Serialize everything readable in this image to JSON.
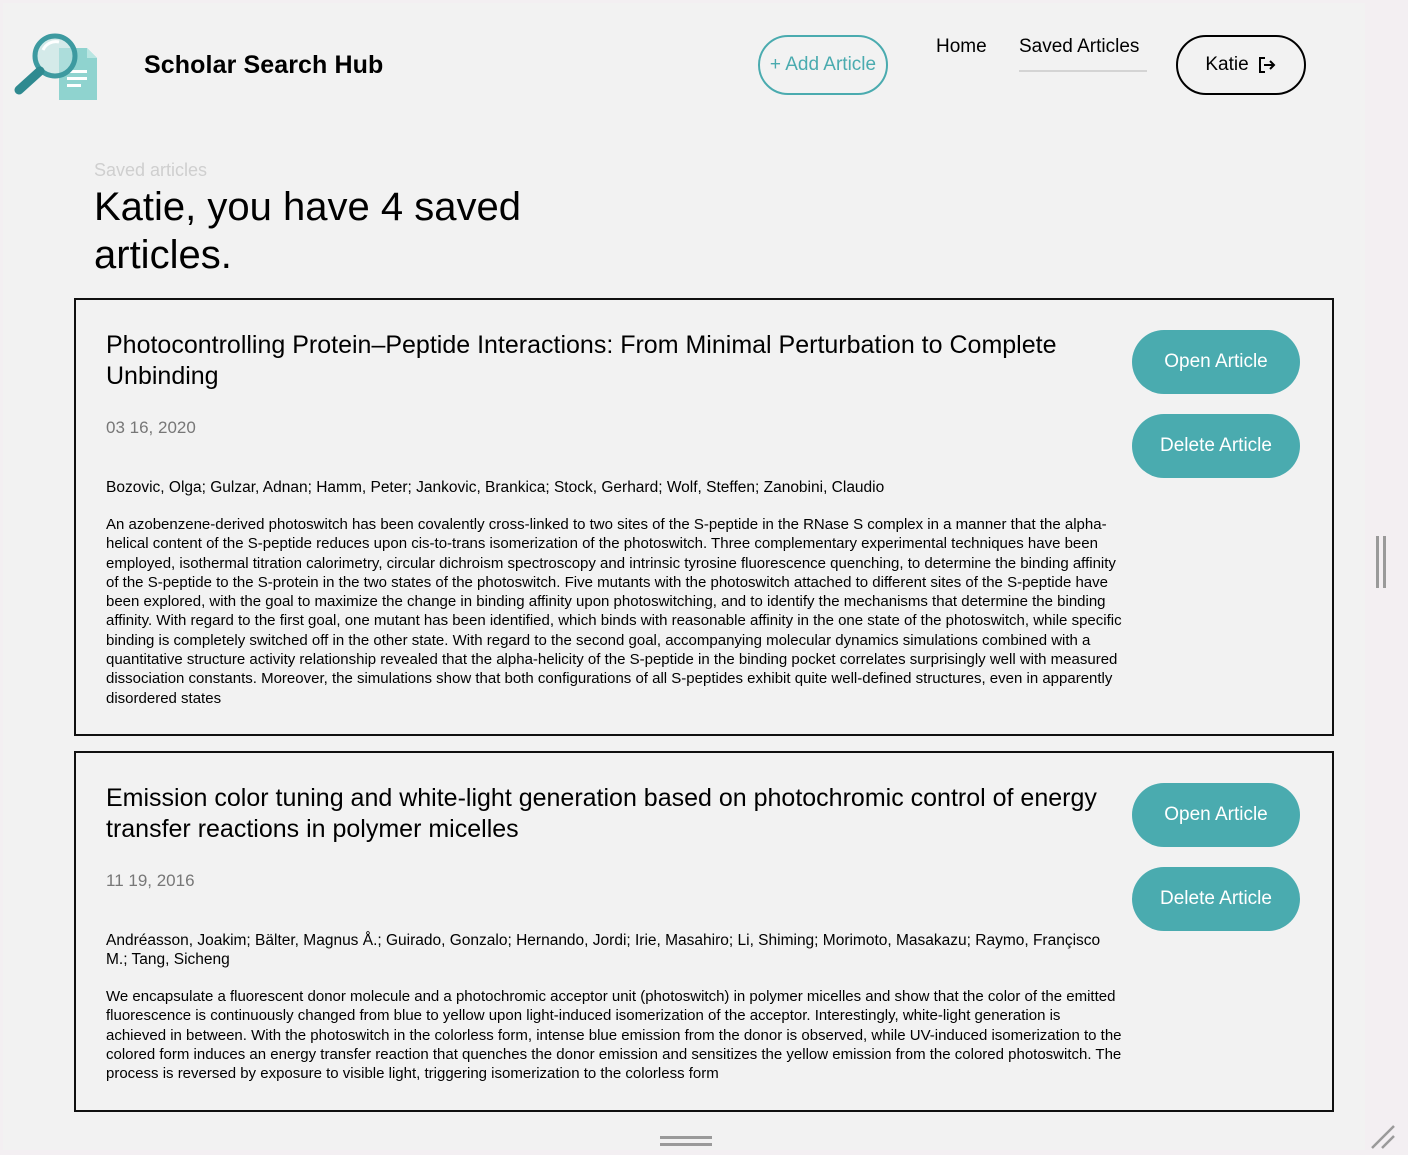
{
  "header": {
    "brand": "Scholar Search Hub",
    "add_label": "+ Add Article",
    "nav": {
      "home": "Home",
      "saved": "Saved Articles"
    },
    "user_name": "Katie"
  },
  "page": {
    "eyebrow": "Saved articles",
    "title": "Katie, you have 4 saved articles."
  },
  "articles": [
    {
      "title": "Photocontrolling Protein–Peptide Interactions: From Minimal Perturbation to Complete Unbinding",
      "date": "03 16, 2020",
      "authors": "Bozovic, Olga; Gulzar, Adnan; Hamm, Peter; Jankovic, Brankica; Stock, Gerhard; Wolf, Steffen; Zanobini, Claudio",
      "abstract": "An azobenzene-derived photoswitch has been covalently cross-linked to two sites of the S-peptide in the RNase S complex in a manner that the alpha-helical content of the S-peptide reduces upon cis-to-trans isomerization of the photoswitch. Three complementary experimental techniques have been employed, isothermal titration calorimetry, circular dichroism spectroscopy and intrinsic tyrosine fluorescence quenching, to determine the binding affinity of the S-peptide to the S-protein in the two states of the photoswitch. Five mutants with the photoswitch attached to different sites of the S-peptide have been explored, with the goal to maximize the change in binding affinity upon photoswitching, and to identify the mechanisms that determine the binding affinity. With regard to the first goal, one mutant has been identified, which binds with reasonable affinity in the one state of the photoswitch, while specific binding is completely switched off in the other state. With regard to the second goal, accompanying molecular dynamics simulations combined with a quantitative structure activity relationship revealed that the alpha-helicity of the S-peptide in the binding pocket correlates surprisingly well with measured dissociation constants. Moreover, the simulations show that both configurations of all S-peptides exhibit quite well-defined structures, even in apparently disordered states",
      "open_label": "Open Article",
      "delete_label": "Delete Article"
    },
    {
      "title": "Emission color tuning and white-light generation based on photochromic control of energy transfer reactions in polymer micelles",
      "date": "11 19, 2016",
      "authors": "Andréasson, Joakim; Bälter, Magnus Å.; Guirado, Gonzalo; Hernando, Jordi; Irie, Masahiro; Li, Shiming; Morimoto, Masakazu; Raymo, Françisco M.; Tang, Sicheng",
      "abstract": "We encapsulate a fluorescent donor molecule and a photochromic acceptor unit (photoswitch) in polymer micelles and show that the color of the emitted fluorescence is continuously changed from blue to yellow upon light-induced isomerization of the acceptor. Interestingly, white-light generation is achieved in between. With the photoswitch in the colorless form, intense blue emission from the donor is observed, while UV-induced isomerization to the colored form induces an energy transfer reaction that quenches the donor emission and sensitizes the yellow emission from the colored photoswitch. The process is reversed by exposure to visible light, triggering isomerization to the colorless form",
      "open_label": "Open Article",
      "delete_label": "Delete Article"
    }
  ],
  "icons": {
    "logo": "magnifier-document-logo",
    "logout": "logout-icon"
  },
  "colors": {
    "accent": "#4aabaf",
    "background": "#f2f2f2"
  }
}
